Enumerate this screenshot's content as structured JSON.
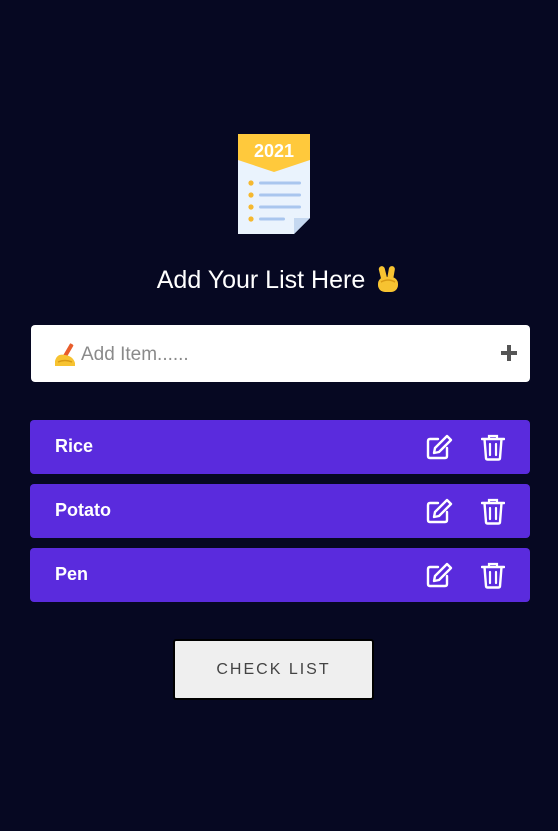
{
  "logo": {
    "year": "2021",
    "icon": "notepad-2021-icon"
  },
  "heading": {
    "text": "Add Your List Here",
    "emoji": "victory-hand-icon"
  },
  "add_item": {
    "placeholder": "Add Item......",
    "value": "",
    "leading_icon": "writing-hand-icon",
    "add_icon": "plus-icon"
  },
  "items": [
    {
      "label": "Rice"
    },
    {
      "label": "Potato"
    },
    {
      "label": "Pen"
    }
  ],
  "check_button": {
    "label": "CHECK LIST"
  },
  "colors": {
    "background": "#060822",
    "item_background": "#5a2bdd",
    "input_background": "#ffffff",
    "button_background": "#efefef"
  }
}
